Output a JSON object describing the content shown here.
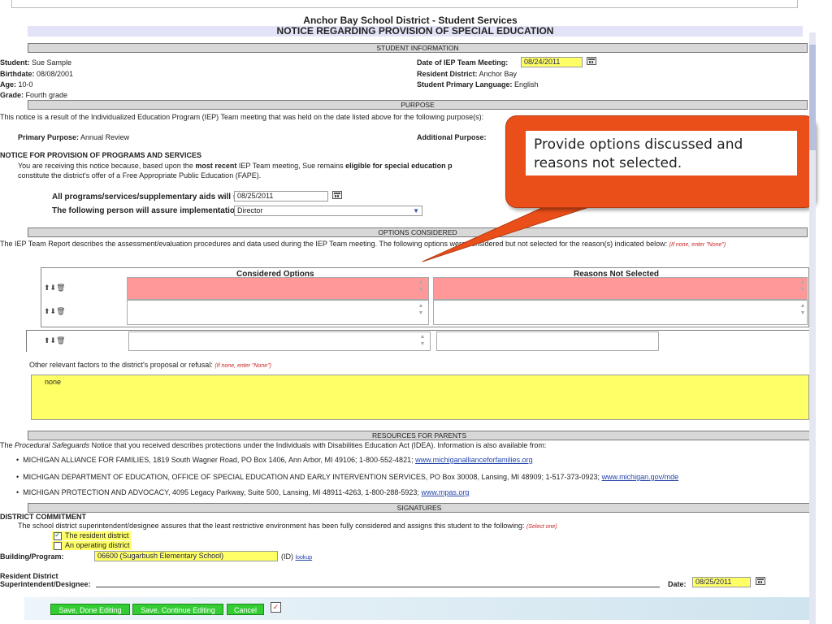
{
  "header": {
    "district_title": "Anchor Bay School District - Student Services",
    "notice_title": "NOTICE REGARDING PROVISION OF SPECIAL EDUCATION"
  },
  "student_info": {
    "bar_label": "STUDENT INFORMATION",
    "student_label": "Student:",
    "student_value": "Sue Sample",
    "birthdate_label": "Birthdate:",
    "birthdate_value": "08/08/2001",
    "age_label": "Age:",
    "age_value": "10-0",
    "grade_label": "Grade:",
    "grade_value": "Fourth grade",
    "meeting_label": "Date of IEP Team Meeting:",
    "meeting_value": "08/24/2011",
    "district_label": "Resident District:",
    "district_value": "Anchor Bay",
    "language_label": "Student Primary Language:",
    "language_value": "English"
  },
  "purpose": {
    "bar_label": "PURPOSE",
    "intro": "This notice is a result of the Individualized Education Program (IEP) Team meeting that was held on the date listed above for the following purpose(s):",
    "primary_label": "Primary Purpose:",
    "primary_value": "Annual Review",
    "additional_label": "Additional Purpose:",
    "notice_heading": "NOTICE FOR PROVISION OF PROGRAMS AND SERVICES",
    "notice_text_a": "You are receiving this notice because, based upon the",
    "notice_text_b": "most recent",
    "notice_text_c": "IEP Team meeting, Sue remains",
    "notice_text_d": "eligible for special education p",
    "notice_text_e": "constitute the district's offer of a Free Appropriate Public Education (FAPE).",
    "start_label": "All programs/services/supplementary aids will start on:",
    "start_value": "08/25/2011",
    "assure_label": "The following person will assure implementation of this IEP:",
    "assure_value": "Director"
  },
  "options": {
    "bar_label": "OPTIONS CONSIDERED",
    "intro": "The IEP Team Report describes the assessment/evaluation procedures and data used during the IEP Team meeting. The following options were considered but not selected for the reason(s) indicated below:",
    "intro_hint": "(If none, enter \"None\")",
    "col_considered": "Considered Options",
    "col_reasons": "Reasons Not Selected",
    "other_label": "Other relevant factors to the district's proposal or refusal:",
    "other_hint": "(If none, enter \"None\")",
    "other_value": "none"
  },
  "callout": {
    "text": "Provide options discussed and reasons not selected."
  },
  "resources": {
    "bar_label": "RESOURCES FOR PARENTS",
    "intro_a": "The",
    "intro_b": "Procedural Safeguards",
    "intro_c": "Notice that you received describes protections under the Individuals with Disabilities Education Act (IDEA). Information is also available from:",
    "items": [
      {
        "text": "MICHIGAN ALLIANCE FOR FAMILIES, 1819 South Wagner Road, PO Box 1406, Ann Arbor, MI 49106; 1-800-552-4821;",
        "link": "www.michiganallianceforfamilies.org"
      },
      {
        "text": "MICHIGAN DEPARTMENT OF EDUCATION, OFFICE OF SPECIAL EDUCATION AND EARLY INTERVENTION SERVICES, PO Box 30008, Lansing, MI 48909; 1-517-373-0923;",
        "link": "www.michigan.gov/mde"
      },
      {
        "text": "MICHIGAN PROTECTION AND ADVOCACY, 4095 Legacy Parkway, Suite 500, Lansing, MI 48911-4263, 1-800-288-5923;",
        "link": "www.mpas.org"
      }
    ]
  },
  "signatures": {
    "bar_label": "SIGNATURES",
    "commitment_heading": "DISTRICT COMMITMENT",
    "commitment_text": "The school district superintendent/designee assures that the least restrictive environment has been fully considered and assigns this student to the following:",
    "commitment_hint": "(Select one)",
    "option_resident": "The resident district",
    "option_operating": "An operating district",
    "resident_checked": true,
    "operating_checked": false,
    "building_label": "Building/Program:",
    "building_value": "06600 (Sugarbush Elementary School)",
    "id_label": "(ID)",
    "lookup_label": "lookup",
    "resident_label_1": "Resident District",
    "resident_label_2": "Superintendent/Designee:",
    "date_label": "Date:",
    "date_value": "08/25/2011"
  },
  "buttons": {
    "save_done": "Save, Done Editing",
    "save_continue": "Save, Continue Editing",
    "cancel": "Cancel"
  },
  "colors": {
    "highlight_yellow": "#ffff66",
    "error_pink": "#ff9999",
    "button_green": "#33cc33",
    "callout_orange": "#ea4f1a"
  }
}
